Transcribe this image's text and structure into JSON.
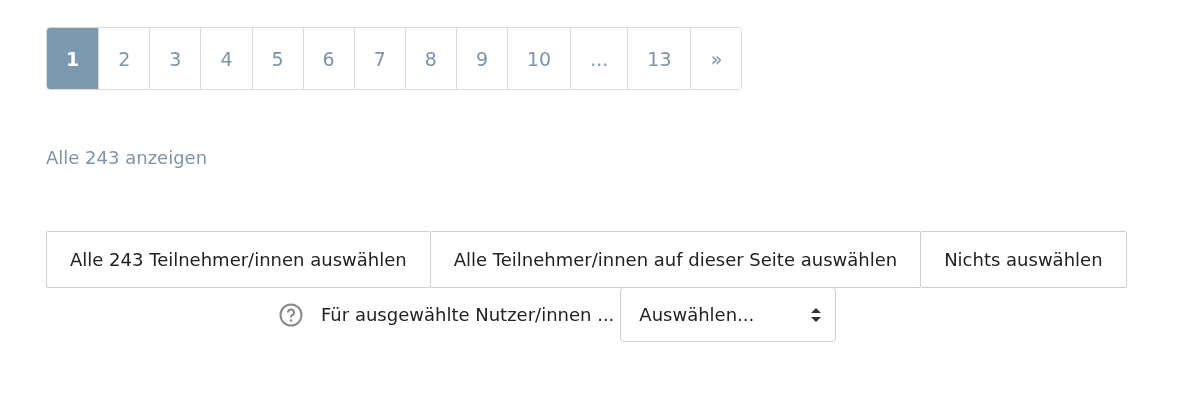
{
  "pagination": [
    {
      "label": "1",
      "selected": true
    },
    {
      "label": "2",
      "selected": false
    },
    {
      "label": "3",
      "selected": false
    },
    {
      "label": "4",
      "selected": false
    },
    {
      "label": "5",
      "selected": false
    },
    {
      "label": "6",
      "selected": false
    },
    {
      "label": "7",
      "selected": false
    },
    {
      "label": "8",
      "selected": false
    },
    {
      "label": "9",
      "selected": false
    },
    {
      "label": "10",
      "selected": false
    },
    {
      "label": "...",
      "selected": false
    },
    {
      "label": "13",
      "selected": false
    },
    {
      "label": "»",
      "selected": false
    }
  ],
  "show_all_link": "Alle 243 anzeigen",
  "buttons": [
    "Alle 243 Teilnehmer/innen auswählen",
    "Alle Teilnehmer/innen auf dieser Seite auswählen",
    "Nichts auswählen"
  ],
  "bulk_action": {
    "label": "Für ausgewählte Nutzer/innen ...",
    "select_value": "Auswählen..."
  }
}
